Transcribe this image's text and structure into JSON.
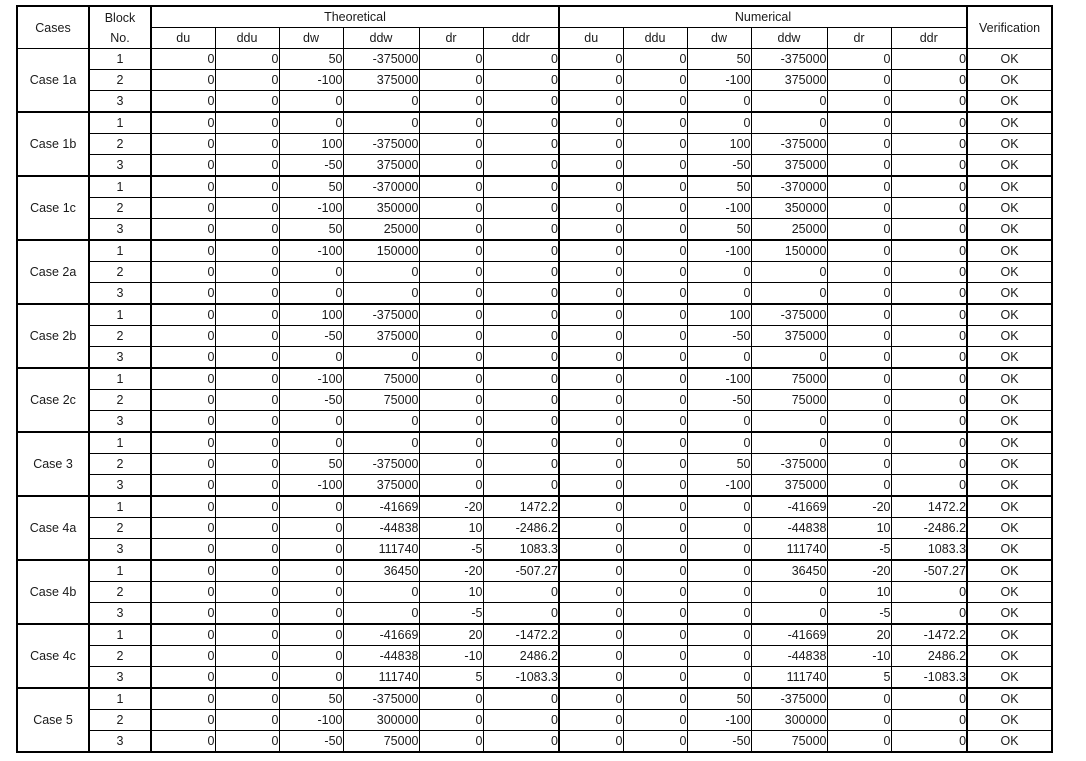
{
  "table": {
    "headers": {
      "cases": "Cases",
      "block_line1": "Block",
      "block_line2": "No.",
      "theoretical": "Theoretical",
      "numerical": "Numerical",
      "verification": "Verification",
      "sub": [
        "du",
        "ddu",
        "dw",
        "ddw",
        "dr",
        "ddr"
      ]
    },
    "verification_value": "OK",
    "groups": [
      {
        "case": "Case 1a",
        "rows": [
          {
            "block": "1",
            "theoretical": [
              "0",
              "0",
              "50",
              "-375000",
              "0",
              "0"
            ],
            "numerical": [
              "0",
              "0",
              "50",
              "-375000",
              "0",
              "0"
            ],
            "verification": "OK"
          },
          {
            "block": "2",
            "theoretical": [
              "0",
              "0",
              "-100",
              "375000",
              "0",
              "0"
            ],
            "numerical": [
              "0",
              "0",
              "-100",
              "375000",
              "0",
              "0"
            ],
            "verification": "OK"
          },
          {
            "block": "3",
            "theoretical": [
              "0",
              "0",
              "0",
              "0",
              "0",
              "0"
            ],
            "numerical": [
              "0",
              "0",
              "0",
              "0",
              "0",
              "0"
            ],
            "verification": "OK"
          }
        ]
      },
      {
        "case": "Case 1b",
        "rows": [
          {
            "block": "1",
            "theoretical": [
              "0",
              "0",
              "0",
              "0",
              "0",
              "0"
            ],
            "numerical": [
              "0",
              "0",
              "0",
              "0",
              "0",
              "0"
            ],
            "verification": "OK"
          },
          {
            "block": "2",
            "theoretical": [
              "0",
              "0",
              "100",
              "-375000",
              "0",
              "0"
            ],
            "numerical": [
              "0",
              "0",
              "100",
              "-375000",
              "0",
              "0"
            ],
            "verification": "OK"
          },
          {
            "block": "3",
            "theoretical": [
              "0",
              "0",
              "-50",
              "375000",
              "0",
              "0"
            ],
            "numerical": [
              "0",
              "0",
              "-50",
              "375000",
              "0",
              "0"
            ],
            "verification": "OK"
          }
        ]
      },
      {
        "case": "Case 1c",
        "rows": [
          {
            "block": "1",
            "theoretical": [
              "0",
              "0",
              "50",
              "-370000",
              "0",
              "0"
            ],
            "numerical": [
              "0",
              "0",
              "50",
              "-370000",
              "0",
              "0"
            ],
            "verification": "OK"
          },
          {
            "block": "2",
            "theoretical": [
              "0",
              "0",
              "-100",
              "350000",
              "0",
              "0"
            ],
            "numerical": [
              "0",
              "0",
              "-100",
              "350000",
              "0",
              "0"
            ],
            "verification": "OK"
          },
          {
            "block": "3",
            "theoretical": [
              "0",
              "0",
              "50",
              "25000",
              "0",
              "0"
            ],
            "numerical": [
              "0",
              "0",
              "50",
              "25000",
              "0",
              "0"
            ],
            "verification": "OK"
          }
        ]
      },
      {
        "case": "Case 2a",
        "rows": [
          {
            "block": "1",
            "theoretical": [
              "0",
              "0",
              "-100",
              "150000",
              "0",
              "0"
            ],
            "numerical": [
              "0",
              "0",
              "-100",
              "150000",
              "0",
              "0"
            ],
            "verification": "OK"
          },
          {
            "block": "2",
            "theoretical": [
              "0",
              "0",
              "0",
              "0",
              "0",
              "0"
            ],
            "numerical": [
              "0",
              "0",
              "0",
              "0",
              "0",
              "0"
            ],
            "verification": "OK"
          },
          {
            "block": "3",
            "theoretical": [
              "0",
              "0",
              "0",
              "0",
              "0",
              "0"
            ],
            "numerical": [
              "0",
              "0",
              "0",
              "0",
              "0",
              "0"
            ],
            "verification": "OK"
          }
        ]
      },
      {
        "case": "Case 2b",
        "rows": [
          {
            "block": "1",
            "theoretical": [
              "0",
              "0",
              "100",
              "-375000",
              "0",
              "0"
            ],
            "numerical": [
              "0",
              "0",
              "100",
              "-375000",
              "0",
              "0"
            ],
            "verification": "OK"
          },
          {
            "block": "2",
            "theoretical": [
              "0",
              "0",
              "-50",
              "375000",
              "0",
              "0"
            ],
            "numerical": [
              "0",
              "0",
              "-50",
              "375000",
              "0",
              "0"
            ],
            "verification": "OK"
          },
          {
            "block": "3",
            "theoretical": [
              "0",
              "0",
              "0",
              "0",
              "0",
              "0"
            ],
            "numerical": [
              "0",
              "0",
              "0",
              "0",
              "0",
              "0"
            ],
            "verification": "OK"
          }
        ]
      },
      {
        "case": "Case 2c",
        "rows": [
          {
            "block": "1",
            "theoretical": [
              "0",
              "0",
              "-100",
              "75000",
              "0",
              "0"
            ],
            "numerical": [
              "0",
              "0",
              "-100",
              "75000",
              "0",
              "0"
            ],
            "verification": "OK"
          },
          {
            "block": "2",
            "theoretical": [
              "0",
              "0",
              "-50",
              "75000",
              "0",
              "0"
            ],
            "numerical": [
              "0",
              "0",
              "-50",
              "75000",
              "0",
              "0"
            ],
            "verification": "OK"
          },
          {
            "block": "3",
            "theoretical": [
              "0",
              "0",
              "0",
              "0",
              "0",
              "0"
            ],
            "numerical": [
              "0",
              "0",
              "0",
              "0",
              "0",
              "0"
            ],
            "verification": "OK"
          }
        ]
      },
      {
        "case": "Case 3",
        "rows": [
          {
            "block": "1",
            "theoretical": [
              "0",
              "0",
              "0",
              "0",
              "0",
              "0"
            ],
            "numerical": [
              "0",
              "0",
              "0",
              "0",
              "0",
              "0"
            ],
            "verification": "OK"
          },
          {
            "block": "2",
            "theoretical": [
              "0",
              "0",
              "50",
              "-375000",
              "0",
              "0"
            ],
            "numerical": [
              "0",
              "0",
              "50",
              "-375000",
              "0",
              "0"
            ],
            "verification": "OK"
          },
          {
            "block": "3",
            "theoretical": [
              "0",
              "0",
              "-100",
              "375000",
              "0",
              "0"
            ],
            "numerical": [
              "0",
              "0",
              "-100",
              "375000",
              "0",
              "0"
            ],
            "verification": "OK"
          }
        ]
      },
      {
        "case": "Case 4a",
        "rows": [
          {
            "block": "1",
            "theoretical": [
              "0",
              "0",
              "0",
              "-41669",
              "-20",
              "1472.2"
            ],
            "numerical": [
              "0",
              "0",
              "0",
              "-41669",
              "-20",
              "1472.2"
            ],
            "verification": "OK"
          },
          {
            "block": "2",
            "theoretical": [
              "0",
              "0",
              "0",
              "-44838",
              "10",
              "-2486.2"
            ],
            "numerical": [
              "0",
              "0",
              "0",
              "-44838",
              "10",
              "-2486.2"
            ],
            "verification": "OK"
          },
          {
            "block": "3",
            "theoretical": [
              "0",
              "0",
              "0",
              "111740",
              "-5",
              "1083.3"
            ],
            "numerical": [
              "0",
              "0",
              "0",
              "111740",
              "-5",
              "1083.3"
            ],
            "verification": "OK"
          }
        ]
      },
      {
        "case": "Case 4b",
        "rows": [
          {
            "block": "1",
            "theoretical": [
              "0",
              "0",
              "0",
              "36450",
              "-20",
              "-507.27"
            ],
            "numerical": [
              "0",
              "0",
              "0",
              "36450",
              "-20",
              "-507.27"
            ],
            "verification": "OK"
          },
          {
            "block": "2",
            "theoretical": [
              "0",
              "0",
              "0",
              "0",
              "10",
              "0"
            ],
            "numerical": [
              "0",
              "0",
              "0",
              "0",
              "10",
              "0"
            ],
            "verification": "OK"
          },
          {
            "block": "3",
            "theoretical": [
              "0",
              "0",
              "0",
              "0",
              "-5",
              "0"
            ],
            "numerical": [
              "0",
              "0",
              "0",
              "0",
              "-5",
              "0"
            ],
            "verification": "OK"
          }
        ]
      },
      {
        "case": "Case 4c",
        "rows": [
          {
            "block": "1",
            "theoretical": [
              "0",
              "0",
              "0",
              "-41669",
              "20",
              "-1472.2"
            ],
            "numerical": [
              "0",
              "0",
              "0",
              "-41669",
              "20",
              "-1472.2"
            ],
            "verification": "OK"
          },
          {
            "block": "2",
            "theoretical": [
              "0",
              "0",
              "0",
              "-44838",
              "-10",
              "2486.2"
            ],
            "numerical": [
              "0",
              "0",
              "0",
              "-44838",
              "-10",
              "2486.2"
            ],
            "verification": "OK"
          },
          {
            "block": "3",
            "theoretical": [
              "0",
              "0",
              "0",
              "111740",
              "5",
              "-1083.3"
            ],
            "numerical": [
              "0",
              "0",
              "0",
              "111740",
              "5",
              "-1083.3"
            ],
            "verification": "OK"
          }
        ]
      },
      {
        "case": "Case 5",
        "rows": [
          {
            "block": "1",
            "theoretical": [
              "0",
              "0",
              "50",
              "-375000",
              "0",
              "0"
            ],
            "numerical": [
              "0",
              "0",
              "50",
              "-375000",
              "0",
              "0"
            ],
            "verification": "OK"
          },
          {
            "block": "2",
            "theoretical": [
              "0",
              "0",
              "-100",
              "300000",
              "0",
              "0"
            ],
            "numerical": [
              "0",
              "0",
              "-100",
              "300000",
              "0",
              "0"
            ],
            "verification": "OK"
          },
          {
            "block": "3",
            "theoretical": [
              "0",
              "0",
              "-50",
              "75000",
              "0",
              "0"
            ],
            "numerical": [
              "0",
              "0",
              "-50",
              "75000",
              "0",
              "0"
            ],
            "verification": "OK"
          }
        ]
      }
    ]
  }
}
